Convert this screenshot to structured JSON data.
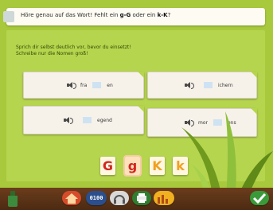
{
  "task": {
    "title_parts": [
      "Höre genau auf das Wort! Fehlt ein ",
      "g-G",
      " oder ein ",
      "k-K",
      "?"
    ]
  },
  "instructions": {
    "line1": "Sprich dir selbst deutlich vor, bevor du einsetzt!",
    "line2": "Schreibe nur die Nomen groß!"
  },
  "cards": [
    {
      "prefix": "fra",
      "suffix": "en"
    },
    {
      "prefix": "",
      "suffix": "ichern"
    },
    {
      "prefix": "",
      "suffix": "egend"
    },
    {
      "prefix": "mor",
      "suffix": "ens"
    }
  ],
  "letters": [
    {
      "label": "G",
      "color": "#d2261f"
    },
    {
      "label": "g",
      "color": "#d2261f"
    },
    {
      "label": "K",
      "color": "#f0a020"
    },
    {
      "label": "k",
      "color": "#f0a020"
    }
  ],
  "toolbar": {
    "counter_value": "0100"
  }
}
